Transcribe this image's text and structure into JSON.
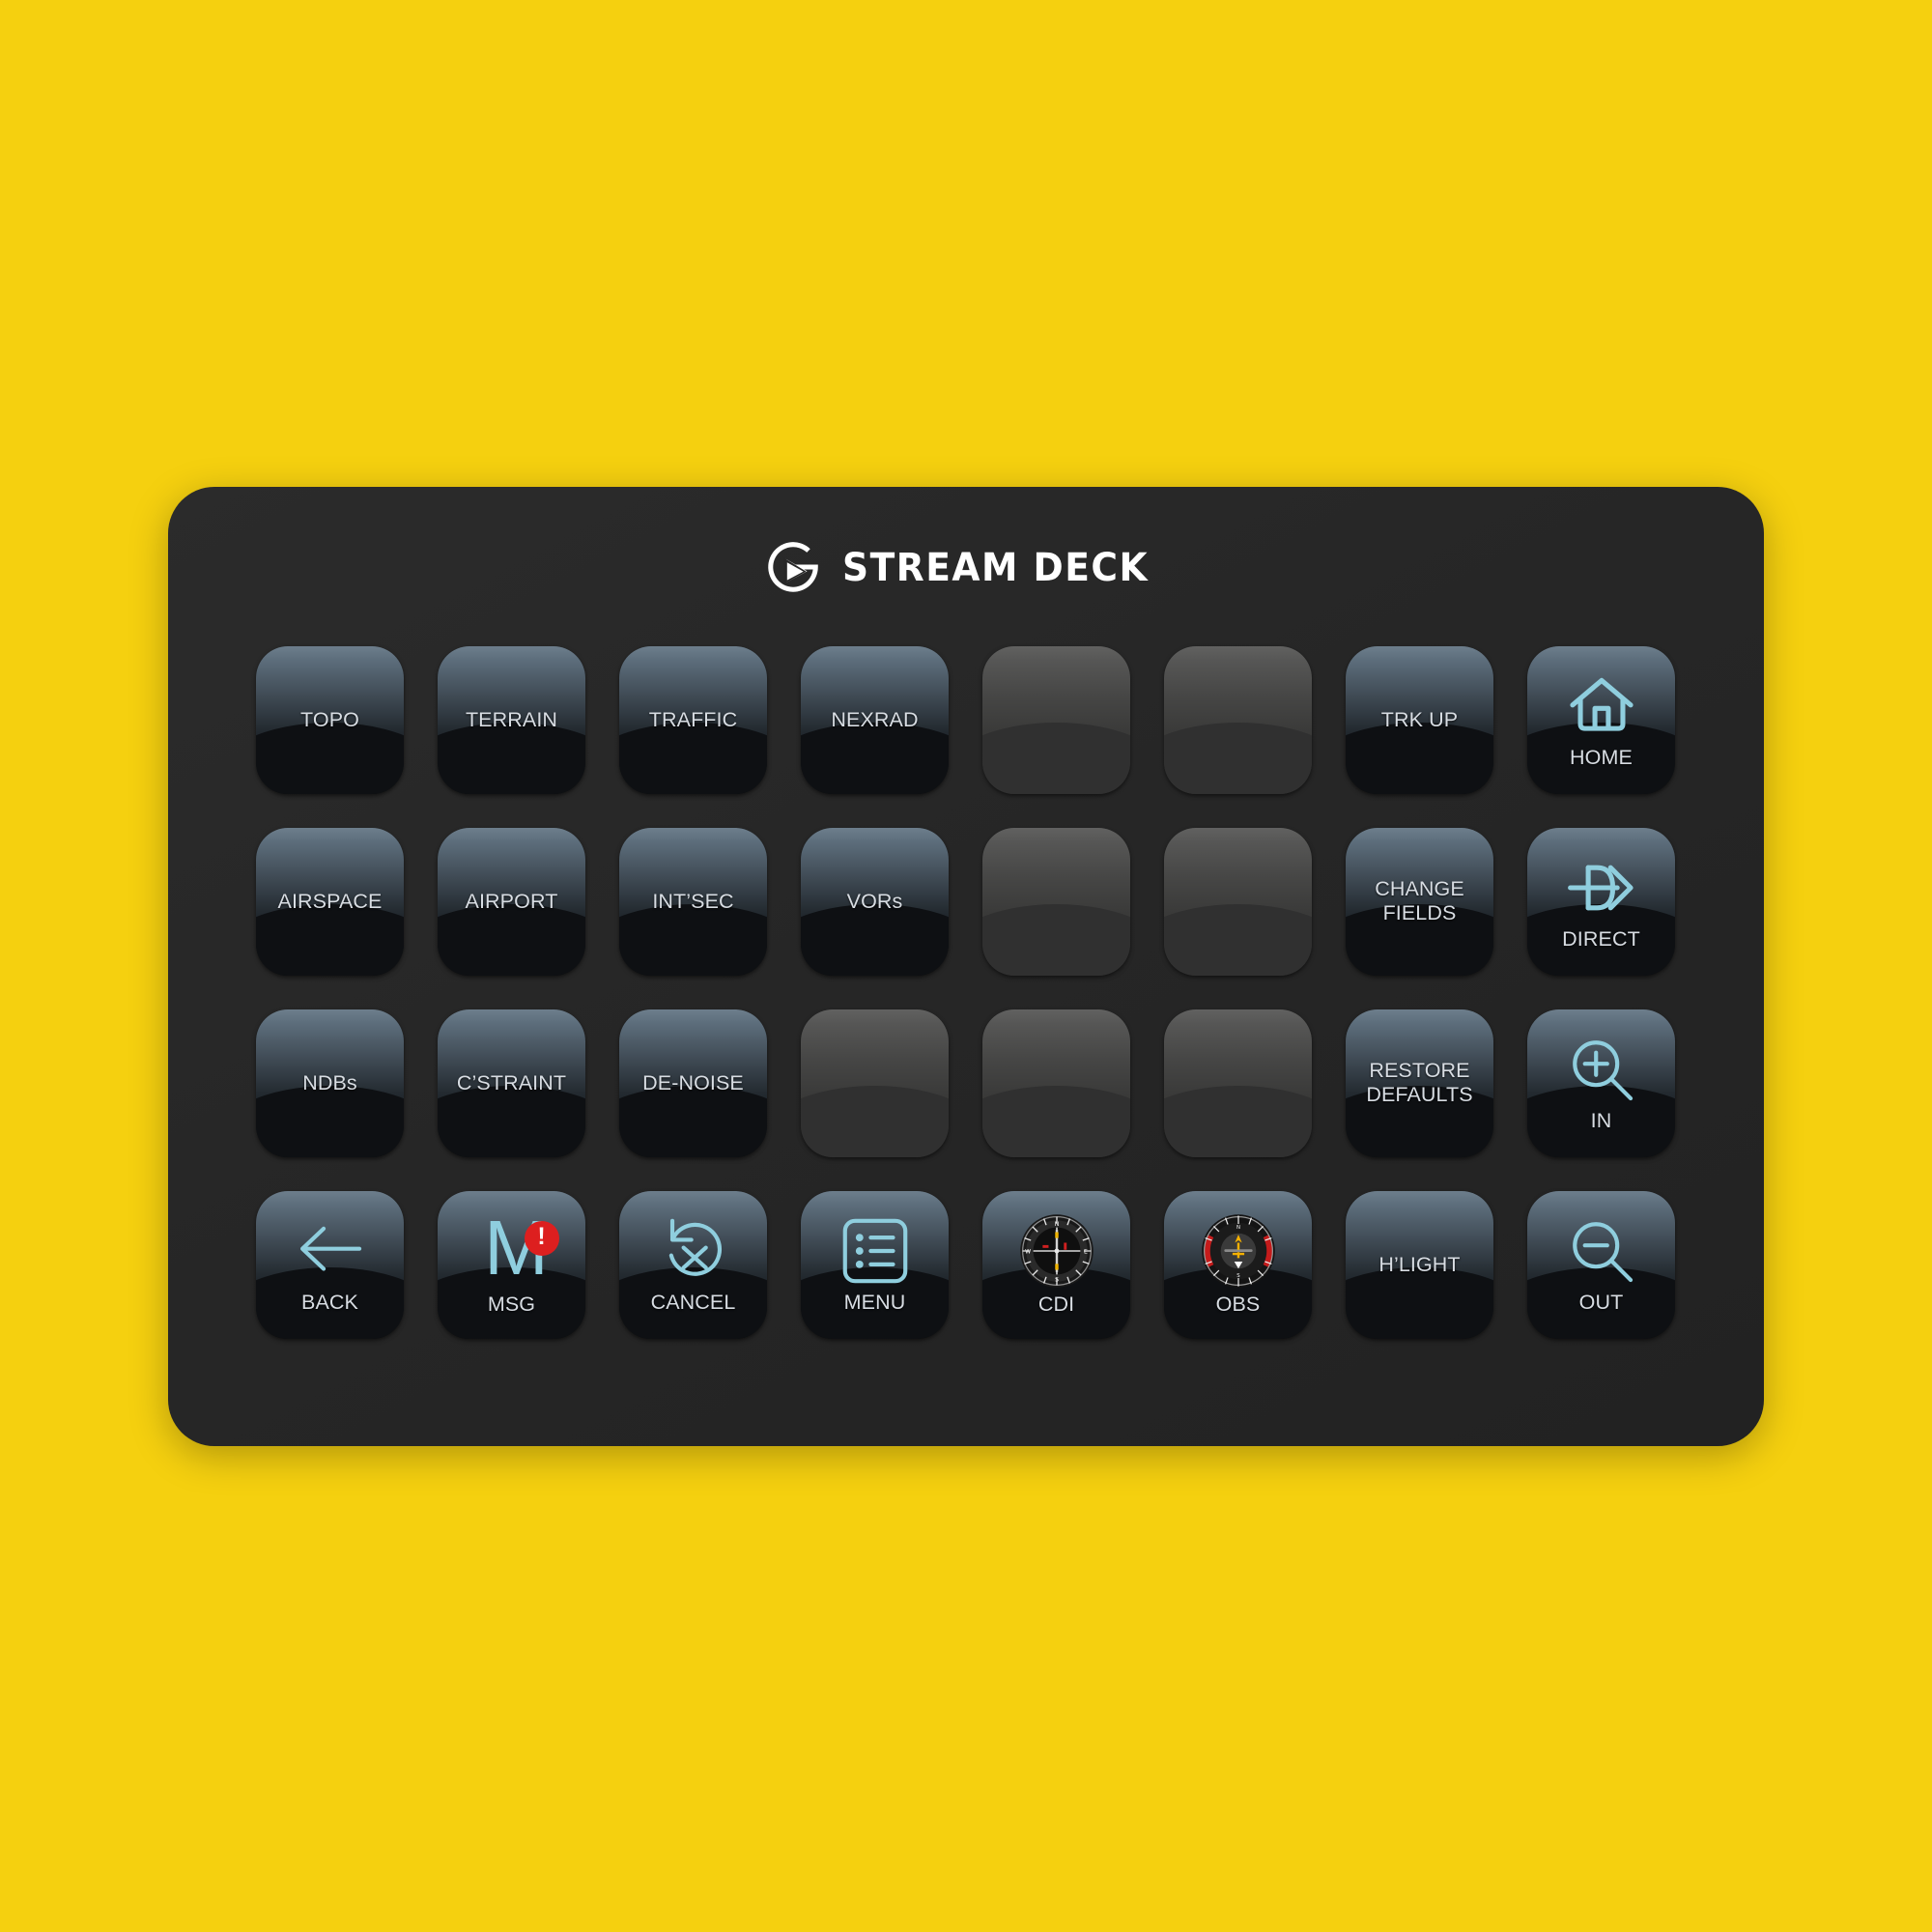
{
  "background_color": "#F5D00F",
  "device": {
    "body_color": "#272727",
    "brand": {
      "name": "STREAM DECK",
      "logo_icon": "elgato-logo-icon",
      "logo_color": "#FFFFFF"
    },
    "grid": {
      "columns": 8,
      "rows": 4,
      "total_keys": 32
    }
  },
  "theme": {
    "key_face_top": "#6D7E8C",
    "key_face_bottom": "#0B0E11",
    "empty_key_top": "#616160",
    "empty_key_bottom": "#2E2E2D",
    "label_color": "#D8DDE3",
    "icon_accent": "#8FCEDE",
    "badge_color": "#DD1F1F"
  },
  "keys": [
    {
      "row": 1,
      "col": 1,
      "label": "TOPO",
      "state": "active",
      "icon": null
    },
    {
      "row": 1,
      "col": 2,
      "label": "TERRAIN",
      "state": "active",
      "icon": null
    },
    {
      "row": 1,
      "col": 3,
      "label": "TRAFFIC",
      "state": "active",
      "icon": null
    },
    {
      "row": 1,
      "col": 4,
      "label": "NEXRAD",
      "state": "active",
      "icon": null
    },
    {
      "row": 1,
      "col": 5,
      "label": "",
      "state": "empty",
      "icon": null
    },
    {
      "row": 1,
      "col": 6,
      "label": "",
      "state": "empty",
      "icon": null
    },
    {
      "row": 1,
      "col": 7,
      "label": "TRK UP",
      "state": "active",
      "icon": null
    },
    {
      "row": 1,
      "col": 8,
      "label": "HOME",
      "state": "active",
      "icon": "home-icon"
    },
    {
      "row": 2,
      "col": 1,
      "label": "AIRSPACE",
      "state": "active",
      "icon": null
    },
    {
      "row": 2,
      "col": 2,
      "label": "AIRPORT",
      "state": "active",
      "icon": null
    },
    {
      "row": 2,
      "col": 3,
      "label": "INT’SEC",
      "state": "active",
      "icon": null
    },
    {
      "row": 2,
      "col": 4,
      "label": "VORs",
      "state": "active",
      "icon": null
    },
    {
      "row": 2,
      "col": 5,
      "label": "",
      "state": "empty",
      "icon": null
    },
    {
      "row": 2,
      "col": 6,
      "label": "",
      "state": "empty",
      "icon": null
    },
    {
      "row": 2,
      "col": 7,
      "label": "CHANGE\nFIELDS",
      "state": "active",
      "icon": null
    },
    {
      "row": 2,
      "col": 8,
      "label": "DIRECT",
      "state": "active",
      "icon": "direct-to-icon"
    },
    {
      "row": 3,
      "col": 1,
      "label": "NDBs",
      "state": "active",
      "icon": null
    },
    {
      "row": 3,
      "col": 2,
      "label": "C’STRAINT",
      "state": "active",
      "icon": null
    },
    {
      "row": 3,
      "col": 3,
      "label": "DE-NOISE",
      "state": "active",
      "icon": null
    },
    {
      "row": 3,
      "col": 4,
      "label": "",
      "state": "empty",
      "icon": null
    },
    {
      "row": 3,
      "col": 5,
      "label": "",
      "state": "empty",
      "icon": null
    },
    {
      "row": 3,
      "col": 6,
      "label": "",
      "state": "empty",
      "icon": null
    },
    {
      "row": 3,
      "col": 7,
      "label": "RESTORE\nDEFAULTS",
      "state": "active",
      "icon": null
    },
    {
      "row": 3,
      "col": 8,
      "label": "IN",
      "state": "active",
      "icon": "zoom-in-icon"
    },
    {
      "row": 4,
      "col": 1,
      "label": "BACK",
      "state": "active",
      "icon": "arrow-left-icon"
    },
    {
      "row": 4,
      "col": 2,
      "label": "MSG",
      "state": "active",
      "icon": "message-alert-icon",
      "badge": "!"
    },
    {
      "row": 4,
      "col": 3,
      "label": "CANCEL",
      "state": "active",
      "icon": "cancel-undo-icon"
    },
    {
      "row": 4,
      "col": 4,
      "label": "MENU",
      "state": "active",
      "icon": "menu-list-icon"
    },
    {
      "row": 4,
      "col": 5,
      "label": "CDI",
      "state": "active",
      "icon": "compass-cdi-icon"
    },
    {
      "row": 4,
      "col": 6,
      "label": "OBS",
      "state": "active",
      "icon": "compass-obs-icon"
    },
    {
      "row": 4,
      "col": 7,
      "label": "H’LIGHT",
      "state": "active",
      "icon": null
    },
    {
      "row": 4,
      "col": 8,
      "label": "OUT",
      "state": "active",
      "icon": "zoom-out-icon"
    }
  ]
}
